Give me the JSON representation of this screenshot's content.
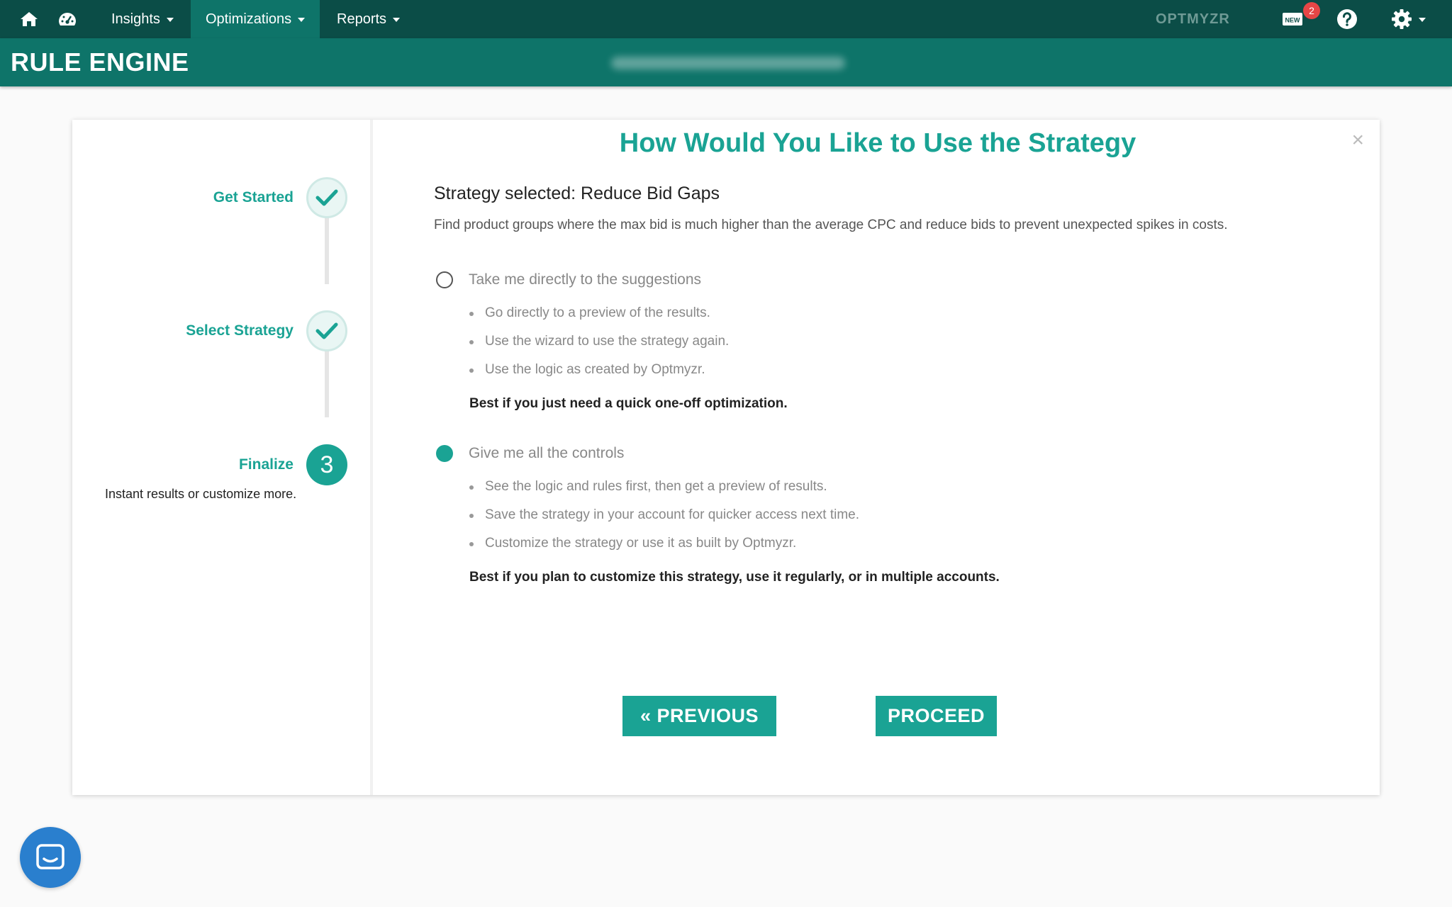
{
  "nav": {
    "items": [
      {
        "label": "Insights",
        "active": false
      },
      {
        "label": "Optimizations",
        "active": true
      },
      {
        "label": "Reports",
        "active": false
      }
    ],
    "brand": "OPTMYZR",
    "news_badge_count": "2",
    "new_label": "NEW"
  },
  "header": {
    "title": "RULE ENGINE"
  },
  "wizard": {
    "steps": [
      {
        "label": "Get Started",
        "status": "done"
      },
      {
        "label": "Select Strategy",
        "status": "done"
      },
      {
        "label": "Finalize",
        "status": "current",
        "number": "3",
        "description": "Instant results or customize more."
      }
    ]
  },
  "modal": {
    "title": "How Would You Like to Use the Strategy",
    "close": "×",
    "strategy_selected": "Strategy selected: Reduce Bid Gaps",
    "strategy_description": "Find product groups where the max bid is much higher than the average CPC and reduce bids to prevent unexpected spikes in costs.",
    "options": [
      {
        "label": "Take me directly to the suggestions",
        "checked": false,
        "bullets": [
          "Go directly to a preview of the results.",
          "Use the wizard to use the strategy again.",
          "Use the logic as created by Optmyzr."
        ],
        "note": "Best if you just need a quick one-off optimization."
      },
      {
        "label": "Give me all the controls",
        "checked": true,
        "bullets": [
          "See the logic and rules first, then get a preview of results.",
          "Save the strategy in your account for quicker access next time.",
          "Customize the strategy or use it as built by Optmyzr."
        ],
        "note": "Best if you plan to customize this strategy, use it regularly, or in multiple accounts."
      }
    ],
    "previous_label": "« PREVIOUS",
    "proceed_label": "PROCEED"
  },
  "colors": {
    "nav_bg": "#0b4d47",
    "header_bg": "#0e7469",
    "accent": "#1aa394",
    "badge": "#e54646",
    "chat": "#2a7fce"
  }
}
